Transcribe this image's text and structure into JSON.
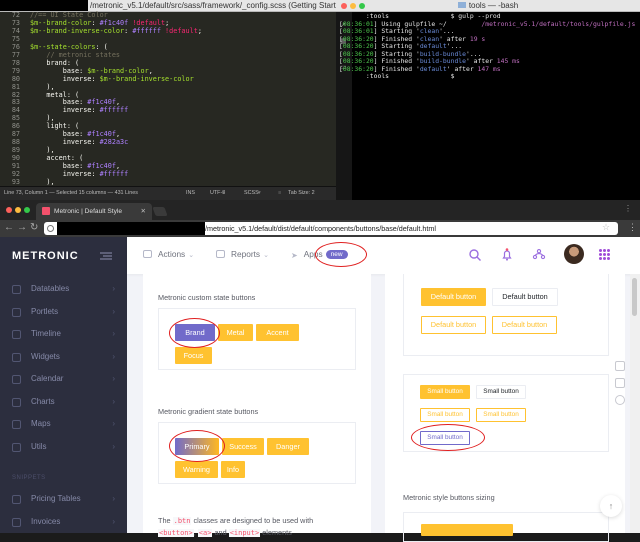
{
  "editor": {
    "title": "/metronic_v5.1/default/src/sass/framework/_config.scss (Getting Started)",
    "lines": [
      {
        "n": "72",
        "parts": [
          {
            "c": "c-comment",
            "t": "//== UI State Color"
          }
        ]
      },
      {
        "n": "73",
        "parts": [
          {
            "c": "c-var",
            "t": "$m--brand-color"
          },
          {
            "c": "c-white",
            "t": ": "
          },
          {
            "c": "c-purple",
            "t": "#f1c40f"
          },
          {
            "c": "c-pink",
            "t": " !default"
          },
          {
            "c": "c-white",
            "t": ";"
          }
        ]
      },
      {
        "n": "74",
        "parts": [
          {
            "c": "c-var",
            "t": "$m--brand-inverse-color"
          },
          {
            "c": "c-white",
            "t": ": "
          },
          {
            "c": "c-purple",
            "t": "#ffffff"
          },
          {
            "c": "c-pink",
            "t": " !default"
          },
          {
            "c": "c-white",
            "t": ";"
          }
        ]
      },
      {
        "n": "75",
        "parts": [
          {
            "c": "c-white",
            "t": ""
          }
        ]
      },
      {
        "n": "76",
        "parts": [
          {
            "c": "c-var",
            "t": "$m--state-colors"
          },
          {
            "c": "c-white",
            "t": ": ("
          }
        ]
      },
      {
        "n": "77",
        "parts": [
          {
            "c": "c-comment",
            "t": "    // metronic states"
          }
        ]
      },
      {
        "n": "78",
        "parts": [
          {
            "c": "c-white",
            "t": "    brand: ("
          }
        ]
      },
      {
        "n": "79",
        "parts": [
          {
            "c": "c-white",
            "t": "        base: "
          },
          {
            "c": "c-var",
            "t": "$m--brand-color"
          },
          {
            "c": "c-white",
            "t": ","
          }
        ]
      },
      {
        "n": "80",
        "parts": [
          {
            "c": "c-white",
            "t": "        inverse: "
          },
          {
            "c": "c-var",
            "t": "$m--brand-inverse-color"
          }
        ]
      },
      {
        "n": "81",
        "parts": [
          {
            "c": "c-white",
            "t": "    ),"
          }
        ]
      },
      {
        "n": "82",
        "parts": [
          {
            "c": "c-white",
            "t": "    metal: ("
          }
        ]
      },
      {
        "n": "83",
        "parts": [
          {
            "c": "c-white",
            "t": "        base: "
          },
          {
            "c": "c-purple",
            "t": "#f1c40f"
          },
          {
            "c": "c-white",
            "t": ","
          }
        ]
      },
      {
        "n": "84",
        "parts": [
          {
            "c": "c-white",
            "t": "        inverse: "
          },
          {
            "c": "c-purple",
            "t": "#ffffff"
          }
        ]
      },
      {
        "n": "85",
        "parts": [
          {
            "c": "c-white",
            "t": "    ),"
          }
        ]
      },
      {
        "n": "86",
        "parts": [
          {
            "c": "c-white",
            "t": "    light: ("
          }
        ]
      },
      {
        "n": "87",
        "parts": [
          {
            "c": "c-white",
            "t": "        base: "
          },
          {
            "c": "c-purple",
            "t": "#f1c40f"
          },
          {
            "c": "c-white",
            "t": ","
          }
        ]
      },
      {
        "n": "88",
        "parts": [
          {
            "c": "c-white",
            "t": "        inverse: "
          },
          {
            "c": "c-purple",
            "t": "#282a3c"
          }
        ]
      },
      {
        "n": "89",
        "parts": [
          {
            "c": "c-white",
            "t": "    ),"
          }
        ]
      },
      {
        "n": "90",
        "parts": [
          {
            "c": "c-white",
            "t": "    accent: ("
          }
        ]
      },
      {
        "n": "91",
        "parts": [
          {
            "c": "c-white",
            "t": "        base: "
          },
          {
            "c": "c-purple",
            "t": "#f1c40f"
          },
          {
            "c": "c-white",
            "t": ","
          }
        ]
      },
      {
        "n": "92",
        "parts": [
          {
            "c": "c-white",
            "t": "        inverse: "
          },
          {
            "c": "c-purple",
            "t": "#ffffff"
          }
        ]
      },
      {
        "n": "93",
        "parts": [
          {
            "c": "c-white",
            "t": "    ),"
          }
        ]
      }
    ],
    "status": {
      "position": "Line 73, Column 1 — Selected 15 columns — 431 Lines",
      "ins": "INS",
      "encoding": "UTF-8",
      "syntax": "SCSS",
      "tab": "Tab Size: 2"
    }
  },
  "terminal": {
    "title": "tools — -bash",
    "lines": [
      [
        {
          "c": "ts",
          "t": "       :tools "
        },
        {
          "c": "rd",
          "t": "              "
        },
        {
          "c": "ts",
          "t": " $ gulp --prod"
        }
      ],
      [
        {
          "c": "ts",
          "t": "["
        },
        {
          "c": "grn",
          "t": "08:36:01"
        },
        {
          "c": "ts",
          "t": "] Using gulpfile ~/"
        },
        {
          "c": "rd",
          "t": "         "
        },
        {
          "c": "mag",
          "t": "/metronic_v5.1/default/tools/gulpfile.js"
        }
      ],
      [
        {
          "c": "ts",
          "t": "["
        },
        {
          "c": "grn",
          "t": "08:36:01"
        },
        {
          "c": "ts",
          "t": "] Starting '"
        },
        {
          "c": "blue",
          "t": "clean"
        },
        {
          "c": "ts",
          "t": "'..."
        }
      ],
      [
        {
          "c": "ts",
          "t": "["
        },
        {
          "c": "grn",
          "t": "08:36:20"
        },
        {
          "c": "ts",
          "t": "] Finished '"
        },
        {
          "c": "blue",
          "t": "clean"
        },
        {
          "c": "ts",
          "t": "' after "
        },
        {
          "c": "mag",
          "t": "19 s"
        }
      ],
      [
        {
          "c": "ts",
          "t": "["
        },
        {
          "c": "grn",
          "t": "08:36:20"
        },
        {
          "c": "ts",
          "t": "] Starting '"
        },
        {
          "c": "blue",
          "t": "default"
        },
        {
          "c": "ts",
          "t": "'..."
        }
      ],
      [
        {
          "c": "ts",
          "t": "["
        },
        {
          "c": "grn",
          "t": "08:36:20"
        },
        {
          "c": "ts",
          "t": "] Starting '"
        },
        {
          "c": "blue",
          "t": "build-bundle"
        },
        {
          "c": "ts",
          "t": "'..."
        }
      ],
      [
        {
          "c": "ts",
          "t": "["
        },
        {
          "c": "grn",
          "t": "08:36:20"
        },
        {
          "c": "ts",
          "t": "] Finished '"
        },
        {
          "c": "blue",
          "t": "build-bundle"
        },
        {
          "c": "ts",
          "t": "' after "
        },
        {
          "c": "mag",
          "t": "145 ms"
        }
      ],
      [
        {
          "c": "ts",
          "t": "["
        },
        {
          "c": "grn",
          "t": "08:36:20"
        },
        {
          "c": "ts",
          "t": "] Finished '"
        },
        {
          "c": "blue",
          "t": "default"
        },
        {
          "c": "ts",
          "t": "' after "
        },
        {
          "c": "mag",
          "t": "147 ms"
        }
      ],
      [
        {
          "c": "ts",
          "t": "       :tools "
        },
        {
          "c": "rd",
          "t": "              "
        },
        {
          "c": "ts",
          "t": " $"
        }
      ]
    ]
  },
  "browser": {
    "tab_title": "Metronic | Default Style",
    "url": "/metronic_v5.1/default/dist/default/components/buttons/base/default.html"
  },
  "app": {
    "brand": "METRONIC",
    "sidebar": {
      "items": [
        {
          "label": "Datatables"
        },
        {
          "label": "Portlets"
        },
        {
          "label": "Timeline"
        },
        {
          "label": "Widgets"
        },
        {
          "label": "Calendar"
        },
        {
          "label": "Charts"
        },
        {
          "label": "Maps"
        },
        {
          "label": "Utils"
        }
      ],
      "section_label": "SNIPPETS",
      "snippet_items": [
        {
          "label": "Pricing Tables"
        },
        {
          "label": "Invoices"
        }
      ]
    },
    "header": {
      "actions": "Actions",
      "reports": "Reports",
      "apps": "Apps",
      "new_badge": "new"
    },
    "left_panel": {
      "custom_title": "Metronic custom state buttons",
      "custom_buttons": [
        "Brand",
        "Metal",
        "Accent",
        "Focus"
      ],
      "gradient_title": "Metronic gradient state buttons",
      "gradient_buttons": [
        "Primary",
        "Success",
        "Danger",
        "Warning",
        "Info"
      ],
      "note_pre": "The",
      "note_code": ".btn",
      "note_post": "classes are designed to be used with",
      "note_line2_code1": "<button>",
      "note_line2_code2": "<a>",
      "note_line2_mid": ", ",
      "note_line2_word": "and",
      "note_line2_code3": "<input>",
      "note_line2_end": "elements"
    },
    "right_panel": {
      "row1": [
        "Default button",
        "Default button"
      ],
      "row2": [
        "Default button",
        "Default button"
      ],
      "small_row1": [
        "Small button",
        "Small button"
      ],
      "small_row2": [
        "Small button",
        "Small button"
      ],
      "small_brand": "Small button",
      "sizing_title": "Metronic style buttons sizing"
    }
  },
  "colors": {
    "brand": "#716aca",
    "warning": "#ffc230",
    "sidebar": "#2c2e3e",
    "annotation": "#e02020"
  }
}
